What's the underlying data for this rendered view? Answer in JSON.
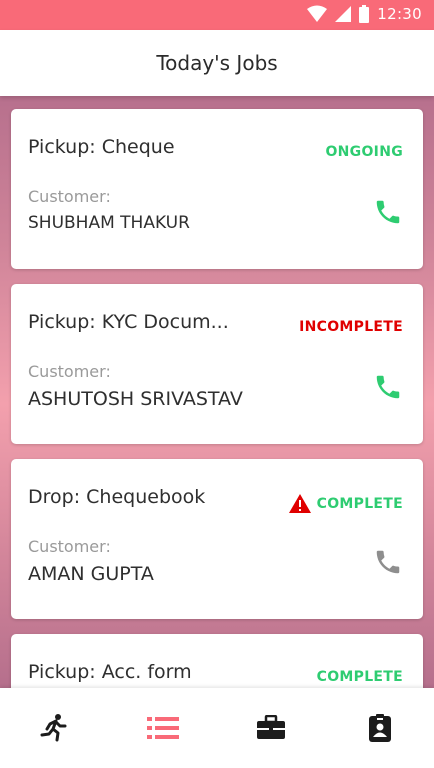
{
  "status_bar": {
    "time": "12:30"
  },
  "app_bar": {
    "title": "Today's Jobs"
  },
  "jobs": [
    {
      "title": "Pickup: Cheque",
      "status": "ONGOING",
      "customer_label": "Customer:",
      "customer_name": "SHUBHAM THAKUR",
      "call_enabled": true
    },
    {
      "title": "Pickup: KYC Docum...",
      "status": "INCOMPLETE",
      "customer_label": "Customer:",
      "customer_name": "ASHUTOSH SRIVASTAV",
      "call_enabled": true
    },
    {
      "title": "Drop: Chequebook",
      "status": "COMPLETE",
      "warning": true,
      "customer_label": "Customer:",
      "customer_name": "AMAN GUPTA",
      "call_enabled": false
    },
    {
      "title": "Pickup: Acc. form",
      "status": "COMPLETE"
    }
  ],
  "bottom_nav": {
    "items": [
      {
        "icon": "running-icon"
      },
      {
        "icon": "list-icon",
        "active": true
      },
      {
        "icon": "briefcase-icon"
      },
      {
        "icon": "id-badge-icon"
      }
    ]
  },
  "colors": {
    "accent": "#f96a78",
    "status_green": "#2ecc71",
    "status_red": "#e00000",
    "phone_active": "#2ecc71",
    "phone_inactive": "#8e8e8e"
  }
}
